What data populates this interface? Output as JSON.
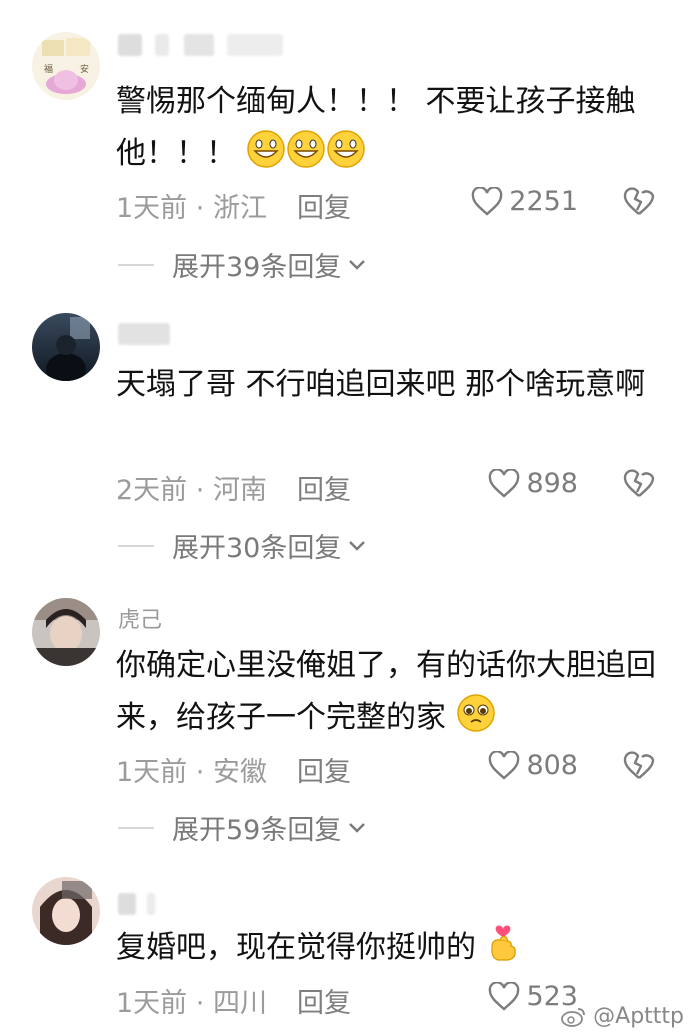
{
  "comments": [
    {
      "username": "",
      "text": "警惕那个缅甸人！！！ 不要让孩子接触他！！！",
      "time": "1天前",
      "location": "浙江",
      "reply_label": "回复",
      "likes": "2251",
      "expand_label": "展开39条回复"
    },
    {
      "username": "",
      "text": "天塌了哥 不行咱追回来吧 那个啥玩意啊",
      "time": "2天前",
      "location": "河南",
      "reply_label": "回复",
      "likes": "898",
      "expand_label": "展开30条回复"
    },
    {
      "username": "虎己",
      "text": "你确定心里没俺姐了，有的话你大胆追回来，给孩子一个完整的家",
      "time": "1天前",
      "location": "安徽",
      "reply_label": "回复",
      "likes": "808",
      "expand_label": "展开59条回复"
    },
    {
      "username": "",
      "text": "复婚吧，现在觉得你挺帅的",
      "time": "1天前",
      "location": "四川",
      "reply_label": "回复",
      "likes": "523"
    }
  ],
  "separator": "·",
  "watermark": "@Aptttp",
  "colors": {
    "text": "#121212",
    "meta": "#9b9b9b",
    "icon": "#7c7c7c"
  }
}
